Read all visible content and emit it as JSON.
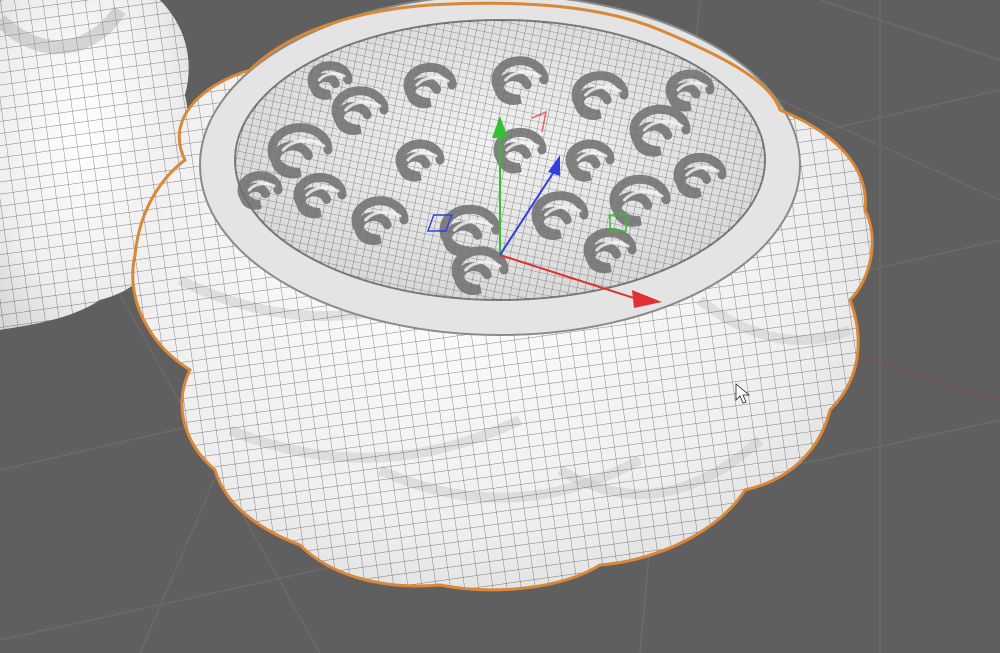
{
  "viewport": {
    "background_color": "#5f5f5f",
    "grid_color": "#737373",
    "mesh_fill_color": "#f4f4f4",
    "wire_color": "#2b2b2b",
    "selection_outline_color": "#d9883a",
    "shading_mode": "shaded-wireframe"
  },
  "objects": [
    {
      "name_icon": "mooncake-mesh",
      "state": "selected"
    },
    {
      "name_icon": "mooncake-mesh",
      "state": "unselected"
    }
  ],
  "gizmo": {
    "type": "move-tool",
    "axis_colors": {
      "x": "#e03030",
      "y": "#30c030",
      "z": "#3040e0"
    }
  },
  "cursor": {
    "icon": "arrow-cursor"
  }
}
